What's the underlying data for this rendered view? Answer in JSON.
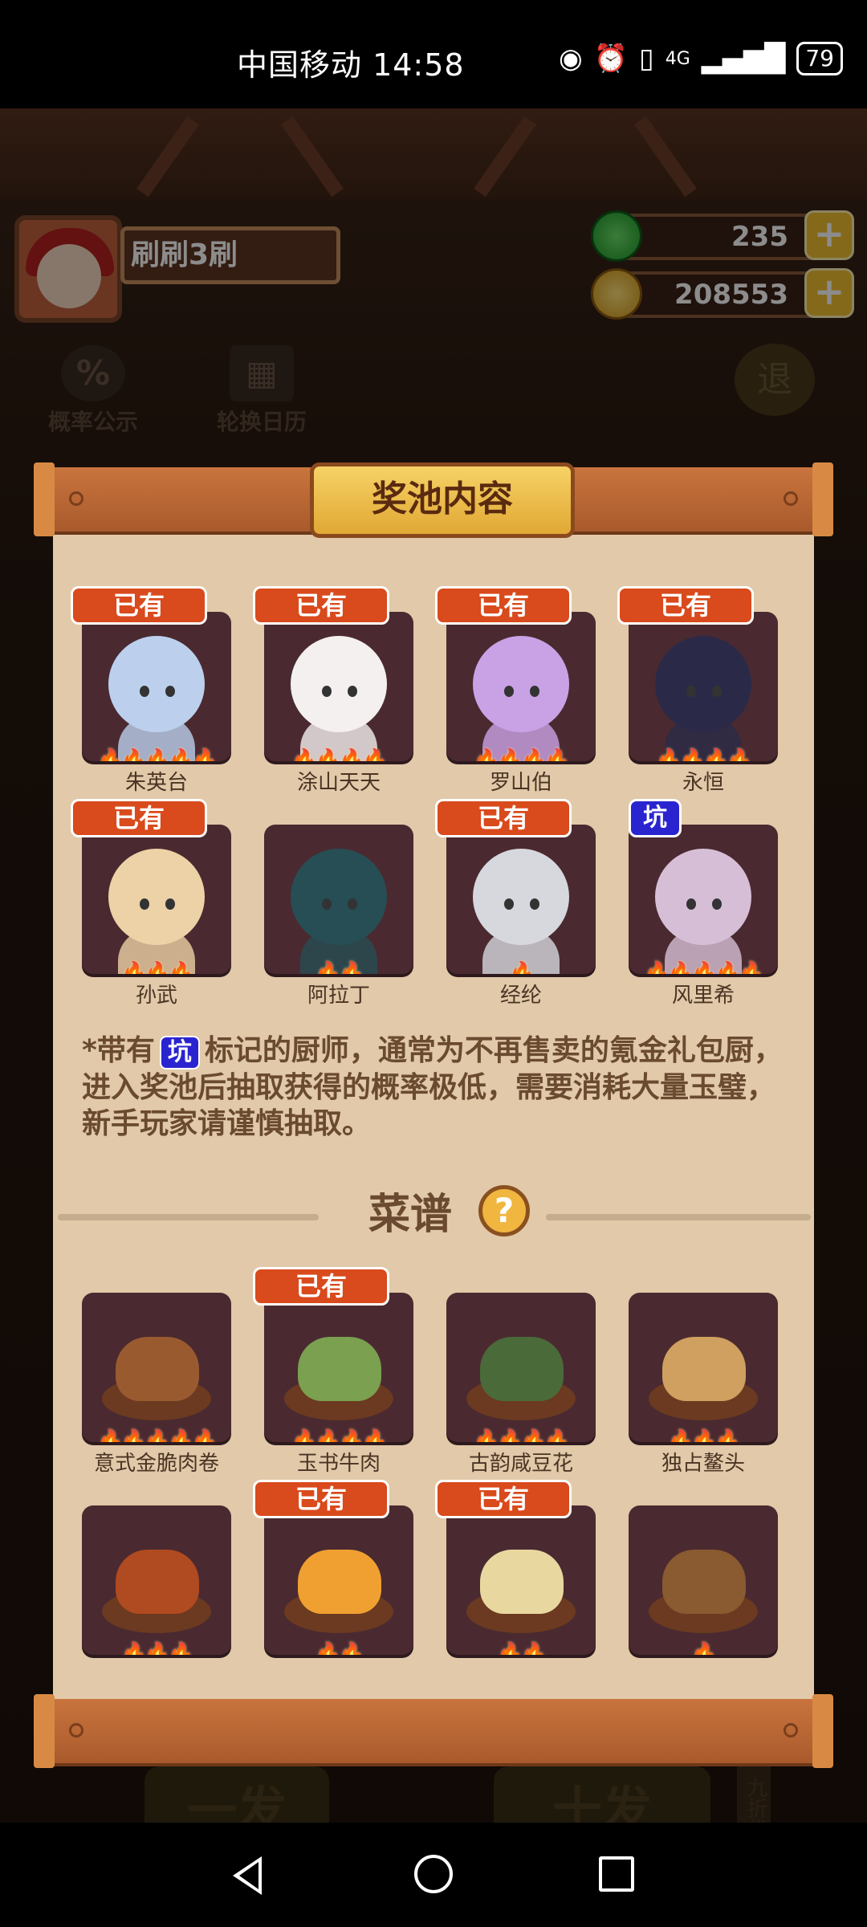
{
  "status_bar": {
    "carrier_time": "中国移动 14:58",
    "network": "4G",
    "battery": "79"
  },
  "player": {
    "name": "刷刷3刷"
  },
  "currency": {
    "jade": "235",
    "coins": "208553",
    "plus_symbol": "+"
  },
  "hud": {
    "probability_label": "概率公示",
    "calendar_label": "轮换日历",
    "exit_label": "退"
  },
  "panel": {
    "title": "奖池内容",
    "owned_label": "已有",
    "pit_label": "坑"
  },
  "chefs": [
    {
      "name": "朱英台",
      "stars": "🔥🔥🔥🔥🔥",
      "owned": true,
      "pit": false,
      "color": "#bcd0ee"
    },
    {
      "name": "涂山天天",
      "stars": "🔥🔥🔥🔥",
      "owned": true,
      "pit": false,
      "color": "#f4f0f0"
    },
    {
      "name": "罗山伯",
      "stars": "🔥🔥🔥🔥",
      "owned": true,
      "pit": false,
      "color": "#c9a2e6"
    },
    {
      "name": "永恒",
      "stars": "🔥🔥🔥🔥",
      "owned": true,
      "pit": false,
      "color": "#2a2a48"
    },
    {
      "name": "孙武",
      "stars": "🔥🔥🔥",
      "owned": true,
      "pit": false,
      "color": "#ecd2a6"
    },
    {
      "name": "阿拉丁",
      "stars": "🔥🔥",
      "owned": false,
      "pit": false,
      "color": "#264e54"
    },
    {
      "name": "经纶",
      "stars": "🔥",
      "owned": true,
      "pit": false,
      "color": "#d6d8de"
    },
    {
      "name": "风里希",
      "stars": "🔥🔥🔥🔥🔥",
      "owned": false,
      "pit": true,
      "color": "#d6bfd6"
    }
  ],
  "note": {
    "prefix": "*带有",
    "pit": "坑",
    "text": "标记的厨师，通常为不再售卖的氪金礼包厨，进入奖池后抽取获得的概率极低，需要消耗大量玉璧，新手玩家请谨慎抽取。"
  },
  "recipes_section": {
    "title": "菜谱",
    "help_symbol": "?"
  },
  "recipes": [
    {
      "name": "意式金脆肉卷",
      "stars": "🔥🔥🔥🔥🔥",
      "owned": false,
      "color": "#9a5a30"
    },
    {
      "name": "玉书牛肉",
      "stars": "🔥🔥🔥🔥",
      "owned": true,
      "color": "#7aa050"
    },
    {
      "name": "古韵咸豆花",
      "stars": "🔥🔥🔥🔥",
      "owned": false,
      "color": "#4a6a3a"
    },
    {
      "name": "独占鳌头",
      "stars": "🔥🔥🔥",
      "owned": false,
      "color": "#d0a060"
    },
    {
      "name": "",
      "stars": "🔥🔥🔥",
      "owned": false,
      "color": "#b04a20"
    },
    {
      "name": "",
      "stars": "🔥🔥",
      "owned": true,
      "color": "#f0a030"
    },
    {
      "name": "",
      "stars": "🔥🔥",
      "owned": true,
      "color": "#e8d8a0"
    },
    {
      "name": "",
      "stars": "🔥",
      "owned": false,
      "color": "#8a5a30"
    }
  ],
  "bottom": {
    "btn_one": "一发",
    "btn_ten": "十发",
    "discount": "九折优惠"
  }
}
